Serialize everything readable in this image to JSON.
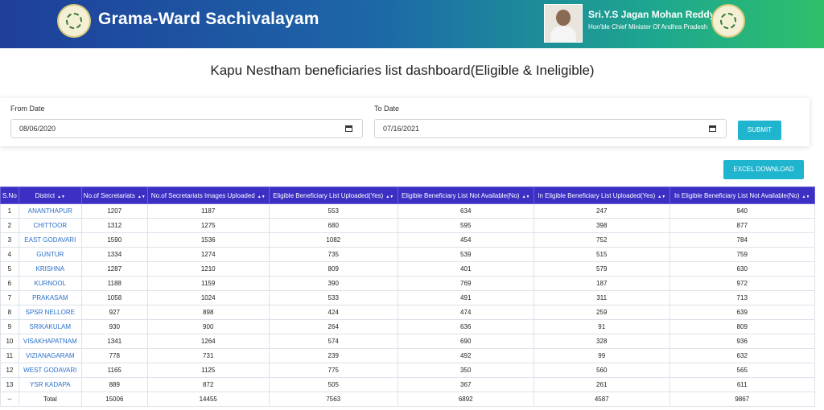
{
  "header": {
    "brand": "Grama-Ward Sachivalayam",
    "cm_name": "Sri.Y.S Jagan Mohan Reddy",
    "cm_title": "Hon'ble Chief Minister Of Andhra Pradesh"
  },
  "page": {
    "title": "Kapu Nestham beneficiaries list dashboard(Eligible & Ineligible)"
  },
  "filters": {
    "from_label": "From Date",
    "from_value": "08/06/2020",
    "to_label": "To Date",
    "to_value": "07/16/2021",
    "submit_label": "SUBMIT"
  },
  "actions": {
    "excel_label": "EXCEL DOWNLOAD"
  },
  "table": {
    "columns": [
      "S.No",
      "District",
      "No.of Secretariats",
      "No.of Secretariats Images Uploaded",
      "Eligible Beneficiary List Uploaded(Yes)",
      "Eligible Beneficiary List Not Available(No)",
      "In Eligible Beneficiary List Uploaded(Yes)",
      "In Eligible Beneficiary List Not Available(No)"
    ],
    "rows": [
      [
        "1",
        "ANANTHAPUR",
        "1207",
        "1187",
        "553",
        "634",
        "247",
        "940"
      ],
      [
        "2",
        "CHITTOOR",
        "1312",
        "1275",
        "680",
        "595",
        "398",
        "877"
      ],
      [
        "3",
        "EAST GODAVARI",
        "1590",
        "1536",
        "1082",
        "454",
        "752",
        "784"
      ],
      [
        "4",
        "GUNTUR",
        "1334",
        "1274",
        "735",
        "539",
        "515",
        "759"
      ],
      [
        "5",
        "KRISHNA",
        "1287",
        "1210",
        "809",
        "401",
        "579",
        "630"
      ],
      [
        "6",
        "KURNOOL",
        "1188",
        "1159",
        "390",
        "769",
        "187",
        "972"
      ],
      [
        "7",
        "PRAKASAM",
        "1058",
        "1024",
        "533",
        "491",
        "311",
        "713"
      ],
      [
        "8",
        "SPSR NELLORE",
        "927",
        "898",
        "424",
        "474",
        "259",
        "639"
      ],
      [
        "9",
        "SRIKAKULAM",
        "930",
        "900",
        "264",
        "636",
        "91",
        "809"
      ],
      [
        "10",
        "VISAKHAPATNAM",
        "1341",
        "1264",
        "574",
        "690",
        "328",
        "936"
      ],
      [
        "11",
        "VIZIANAGARAM",
        "778",
        "731",
        "239",
        "492",
        "99",
        "632"
      ],
      [
        "12",
        "WEST GODAVARI",
        "1165",
        "1125",
        "775",
        "350",
        "560",
        "565"
      ],
      [
        "13",
        "YSR KADAPA",
        "889",
        "872",
        "505",
        "367",
        "261",
        "611"
      ]
    ],
    "total": [
      "--",
      "Total",
      "15006",
      "14455",
      "7563",
      "6892",
      "4587",
      "9867"
    ]
  }
}
